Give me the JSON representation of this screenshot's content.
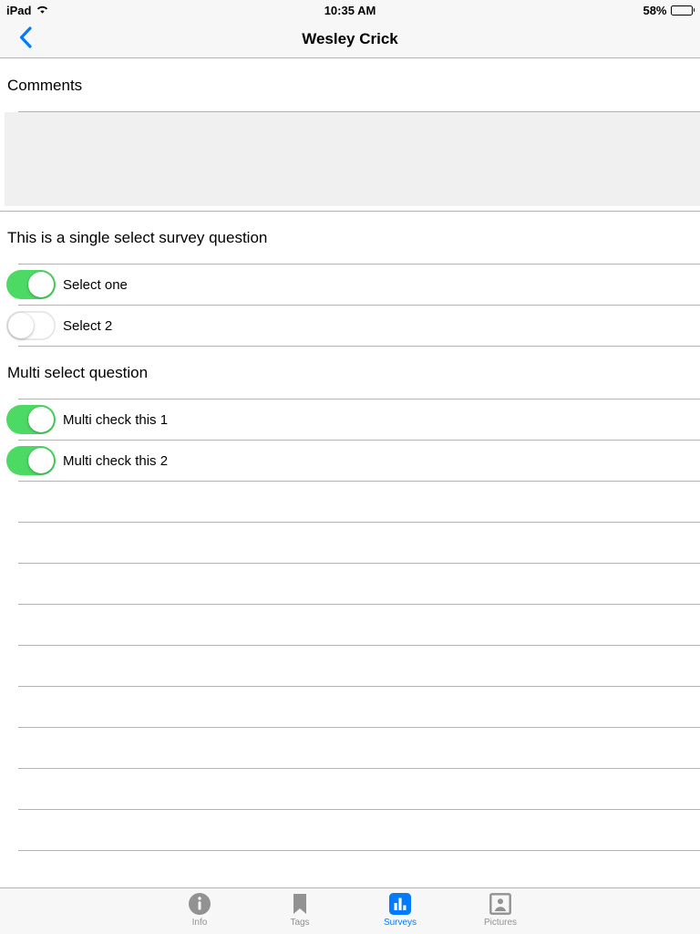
{
  "status_bar": {
    "device": "iPad",
    "wifi_icon": "wifi-icon",
    "time": "10:35 AM",
    "battery_percent": "58%",
    "battery_level": 58,
    "battery_icon": "battery-icon"
  },
  "nav_bar": {
    "back_icon": "chevron-left-icon",
    "title": "Wesley Crick",
    "accent_color": "#007aff"
  },
  "form": {
    "comments": {
      "label": "Comments",
      "value": "",
      "placeholder": ""
    },
    "questions": [
      {
        "title": "This is a single select survey question",
        "type": "single-select",
        "options": [
          {
            "label": "Select one",
            "selected": true
          },
          {
            "label": "Select 2",
            "selected": false
          }
        ]
      },
      {
        "title": "Multi select question",
        "type": "multi-select",
        "options": [
          {
            "label": "Multi check this 1",
            "selected": true
          },
          {
            "label": "Multi check this 2",
            "selected": true
          }
        ]
      }
    ],
    "empty_row_count": 9,
    "toggle_on_color": "#4cd964",
    "separator_color": "#b2b2b2",
    "comment_box_color": "#f0f0f0"
  },
  "tab_bar": {
    "tabs": [
      {
        "label": "Info",
        "icon": "info-circle-icon",
        "selected": false
      },
      {
        "label": "Tags",
        "icon": "bookmark-icon",
        "selected": false
      },
      {
        "label": "Surveys",
        "icon": "bar-chart-icon",
        "selected": true
      },
      {
        "label": "Pictures",
        "icon": "picture-person-icon",
        "selected": false
      }
    ],
    "selected_color": "#007aff",
    "inactive_color": "#929292"
  }
}
